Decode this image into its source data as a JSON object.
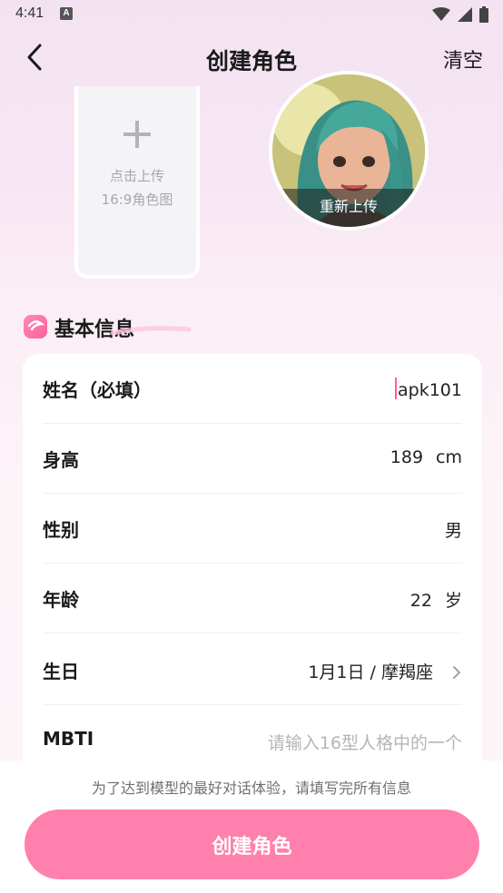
{
  "status_bar": {
    "time": "4:41",
    "notification_icon": "A"
  },
  "header": {
    "back_icon": "chevron-left-icon",
    "title": "创建角色",
    "clear_label": "清空"
  },
  "upload": {
    "plus_icon": "plus-icon",
    "line1": "点击上传",
    "line2": "16:9角色图"
  },
  "avatar": {
    "reupload_label": "重新上传"
  },
  "section": {
    "title": "基本信息"
  },
  "form": {
    "name": {
      "label": "姓名（必填）",
      "value": "apk101"
    },
    "height": {
      "label": "身高",
      "value": "189",
      "unit": "cm"
    },
    "gender": {
      "label": "性别",
      "value": "男"
    },
    "age": {
      "label": "年龄",
      "value": "22",
      "unit": "岁"
    },
    "birthday": {
      "label": "生日",
      "value": "1月1日 / 摩羯座"
    },
    "mbti": {
      "label": "MBTI",
      "placeholder": "请输入16型人格中的一个"
    }
  },
  "footer": {
    "hint": "为了达到模型的最好对话体验，请填写完所有信息",
    "create_label": "创建角色"
  },
  "colors": {
    "accent": "#ff80ad",
    "background": "#f7e6f3"
  }
}
